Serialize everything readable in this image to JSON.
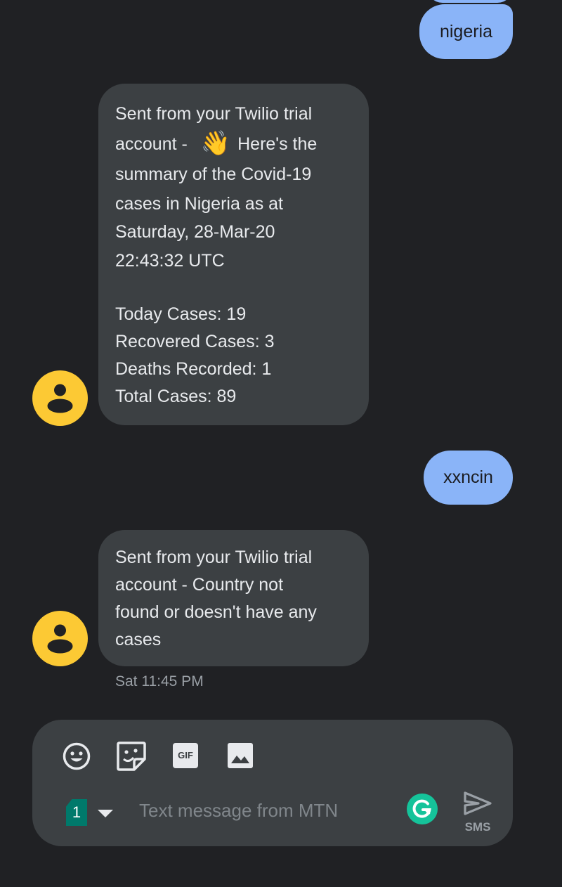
{
  "conversation": {
    "outgoing_1": "nigeria",
    "incoming_1": {
      "lines": [
        "Sent from your Twilio trial",
        "account - ",
        "Here's the",
        "summary of the Covid-19",
        "cases in Nigeria as at",
        "Saturday, 28-Mar-20",
        "22:43:32 UTC",
        "Today Cases: 19",
        "Recovered Cases: 3",
        "Deaths Recorded: 1",
        "Total Cases: 89"
      ],
      "emoji": "👋"
    },
    "outgoing_2": "xxncin",
    "incoming_2": {
      "lines": [
        "Sent from your Twilio trial",
        "account - Country not",
        "found or doesn't have any",
        "cases"
      ]
    },
    "timestamp": "Sat 11:45 PM"
  },
  "composer": {
    "placeholder": "Text message from MTN",
    "sim_number": "1",
    "send_label": "SMS",
    "icons": [
      "emoji-icon",
      "sticker-icon",
      "gif-icon",
      "image-icon",
      "grammarly-icon",
      "send-icon"
    ],
    "gif_label": "GIF"
  },
  "colors": {
    "background": "#202124",
    "outgoing_bubble": "#8ab4f8",
    "incoming_bubble": "#3c4043",
    "avatar": "#fcc934",
    "grammarly": "#15c39a",
    "sim": "#00796b"
  }
}
